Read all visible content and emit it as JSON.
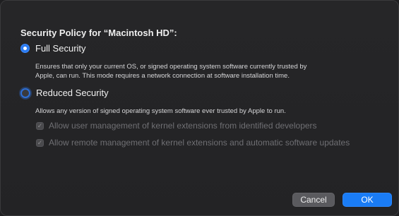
{
  "dialog": {
    "title": "Security Policy for “Macintosh HD”:",
    "options": [
      {
        "label": "Full Security",
        "selected": true,
        "description_lines": [
          "Ensures that only your current OS, or signed operating system software currently trusted by",
          "Apple, can run. This mode requires a network connection at software installation time."
        ]
      },
      {
        "label": "Reduced Security",
        "selected": false,
        "description_lines": [
          "Allows any version of signed operating system software ever trusted by Apple to run."
        ]
      }
    ],
    "checkboxes": [
      {
        "label": "Allow user management of kernel extensions from identified developers",
        "checked": true,
        "enabled": false,
        "glyph": "✓"
      },
      {
        "label": "Allow remote management of kernel extensions and automatic software updates",
        "checked": true,
        "enabled": false,
        "glyph": "✓"
      }
    ],
    "buttons": {
      "cancel": "Cancel",
      "ok": "OK"
    },
    "colors": {
      "accent": "#1a7cf5",
      "background": "#242426",
      "disabled_text": "#6f6f73"
    }
  }
}
